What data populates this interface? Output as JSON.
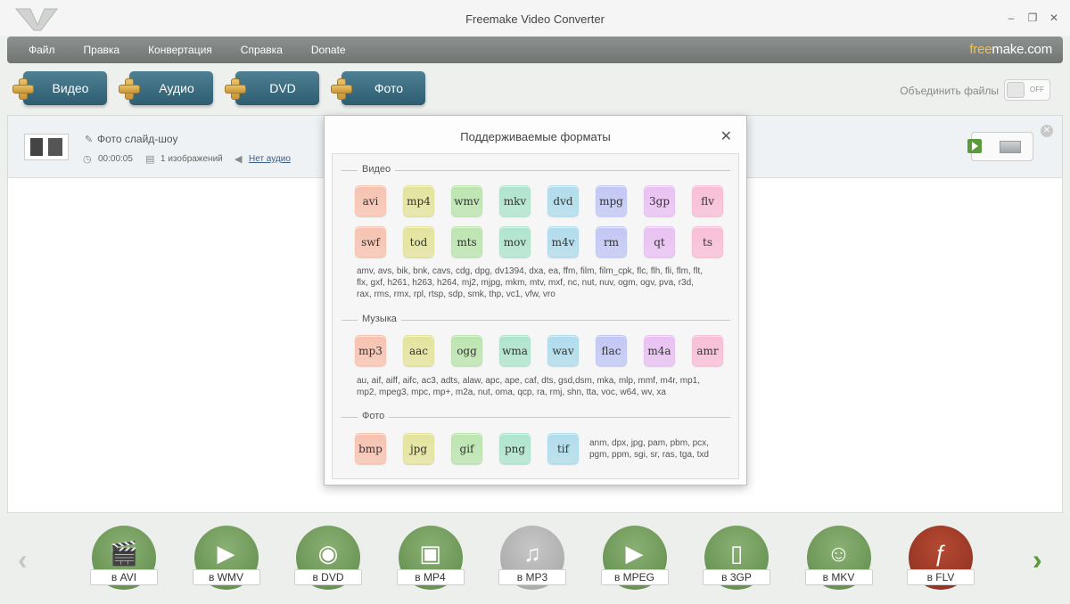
{
  "window": {
    "title": "Freemake Video Converter",
    "minimize": "–",
    "restore": "❐",
    "close": "✕"
  },
  "menu": {
    "items": [
      "Файл",
      "Правка",
      "Конвертация",
      "Справка",
      "Donate"
    ],
    "brand_free": "free",
    "brand_rest": "make.com"
  },
  "toolbar": {
    "add_video": "Видео",
    "add_audio": "Аудио",
    "add_dvd": "DVD",
    "add_photo": "Фото",
    "merge_label": "Объединить файлы",
    "merge_toggle": "OFF"
  },
  "file": {
    "name": "Фото слайд-шоу",
    "duration": "00:00:05",
    "images": "1 изображений",
    "audio": "Нет аудио"
  },
  "dialog": {
    "title": "Поддерживаемые форматы",
    "close": "✕",
    "video_label": "Видео",
    "video_formats": [
      "avi",
      "mp4",
      "wmv",
      "mkv",
      "dvd",
      "mpg",
      "3gp",
      "flv",
      "swf",
      "tod",
      "mts",
      "mov",
      "m4v",
      "rm",
      "qt",
      "ts"
    ],
    "video_ext": [
      "amv, avs, bik, bnk, cavs, cdg, dpg, dv1394, dxa, ea, ffm, film, film_cpk, flc, flh, fli, flm, flt,",
      "flx, gxf, h261, h263, h264, mj2, mjpg, mkm, mtv, mxf, nc, nut, nuv, ogm, ogv, pva, r3d,",
      "rax, rms, rmx, rpl, rtsp, sdp, smk, thp, vc1, vfw, vro"
    ],
    "music_label": "Музыка",
    "music_formats": [
      "mp3",
      "aac",
      "ogg",
      "wma",
      "wav",
      "flac",
      "m4a",
      "amr"
    ],
    "music_ext": [
      "au, aif, aiff, aifc, ac3, adts, alaw, apc, ape, caf, dts, gsd,dsm, mka, mlp, mmf, m4r, mp1,",
      "mp2, mpeg3, mpc, mp+, m2a, nut, oma, qcp, ra, rmj, shn, tta, voc, w64, wv, xa"
    ],
    "photo_label": "Фото",
    "photo_formats": [
      "bmp",
      "jpg",
      "gif",
      "png",
      "tif"
    ],
    "photo_ext": [
      "anm, dpx, jpg, pam, pbm, pcx,",
      "pgm, ppm, sgi, sr, ras, tga, txd"
    ]
  },
  "colors": {
    "video": [
      "#f3c4b4",
      "#e3e3a4",
      "#bfe3b4",
      "#b4e3cf",
      "#b4dbe9",
      "#c3c8f0",
      "#e6c3ef",
      "#f4c0d6"
    ],
    "music": [
      "#f3c4b4",
      "#e3e3a4",
      "#bfe3b4",
      "#b4e3cf",
      "#b4dbe9",
      "#c3c8f0",
      "#e6c3ef",
      "#f4c0d6"
    ],
    "photo": [
      "#f3c4b4",
      "#e3e3a4",
      "#bfe3b4",
      "#b4e3cf",
      "#b4dbe9"
    ]
  },
  "targets": [
    {
      "label": "в AVI",
      "icon": "clapper-icon"
    },
    {
      "label": "в WMV",
      "icon": "windows-media-icon"
    },
    {
      "label": "в DVD",
      "icon": "disc-icon"
    },
    {
      "label": "в MP4",
      "icon": "phone-media-icon"
    },
    {
      "label": "в MP3",
      "icon": "headphones-icon"
    },
    {
      "label": "в MPEG",
      "icon": "tv-icon"
    },
    {
      "label": "в 3GP",
      "icon": "mobile-phone-icon"
    },
    {
      "label": "в MKV",
      "icon": "matryoshka-icon"
    },
    {
      "label": "в FLV",
      "icon": "flash-icon"
    }
  ],
  "nav": {
    "prev": "‹",
    "next": "›"
  }
}
